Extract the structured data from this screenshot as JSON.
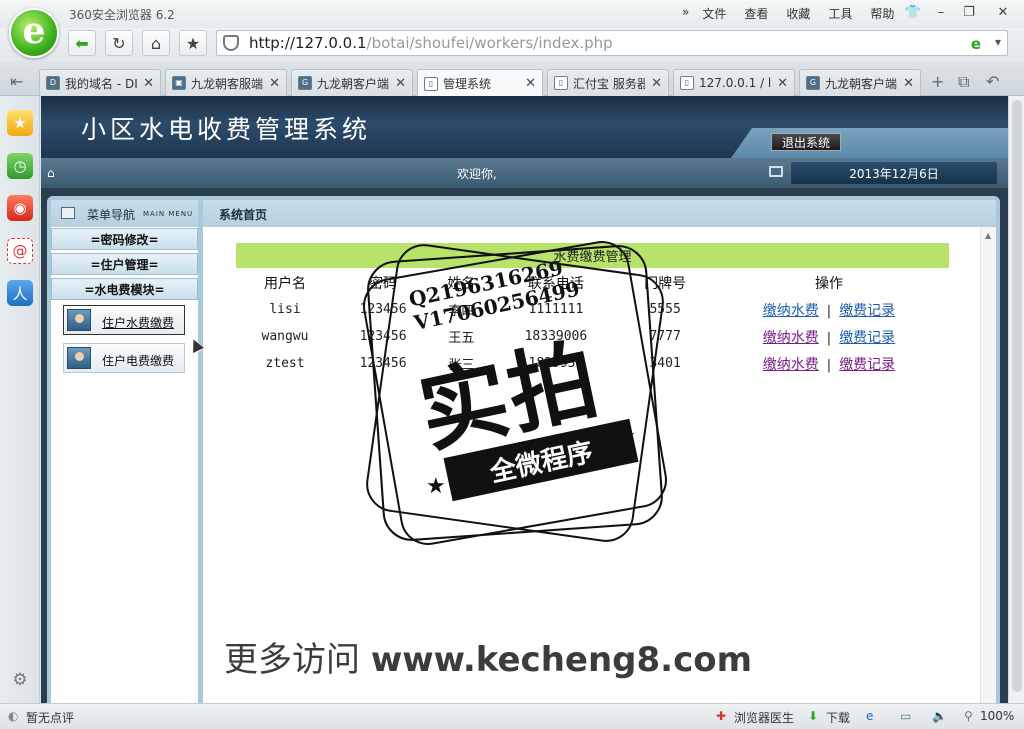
{
  "browser": {
    "app_title": "360安全浏览器 6.2",
    "menu": [
      "文件",
      "查看",
      "收藏",
      "工具",
      "帮助"
    ],
    "url_host": "http://127.0.0.1",
    "url_path": "/botai/shoufei/workers/index.php",
    "tabs": [
      {
        "label": "我的域名 - DI",
        "icon": "D"
      },
      {
        "label": "九龙朝客服端",
        "icon": "▣"
      },
      {
        "label": "九龙朝客户端",
        "icon": "G"
      },
      {
        "label": "管理系统",
        "icon": "▯"
      },
      {
        "label": "汇付宝 服务器",
        "icon": "▯"
      },
      {
        "label": "127.0.0.1 / lo",
        "icon": "▯"
      },
      {
        "label": "九龙朝客户端",
        "icon": "G"
      }
    ],
    "status_left": "暂无点评",
    "status_right": [
      "浏览器医生",
      "下载",
      "100%"
    ]
  },
  "site": {
    "title": "小区水电收费管理系统",
    "logout": "退出系统",
    "welcome": "欢迎你,",
    "date": "2013年12月6日"
  },
  "nav": {
    "title": "菜单导航",
    "subtitle": "MAIN MENU",
    "items": [
      "=密码修改=",
      "=住户管理=",
      "=水电费模块="
    ],
    "sub_items": [
      "住户水费缴费",
      "住户电费缴费"
    ]
  },
  "main": {
    "breadcrumb": "系统首页",
    "section_title": "水费缴费管理",
    "columns": [
      "用户名",
      "密码",
      "姓名",
      "联系电话",
      "门牌号",
      "操作"
    ],
    "rows": [
      {
        "username": "lisi",
        "password": "123456",
        "name": "李四",
        "phone": "1111111",
        "door": "5555",
        "pay": "缴纳水费",
        "history": "缴费记录"
      },
      {
        "username": "wangwu",
        "password": "123456",
        "name": "王五",
        "phone": "18339006",
        "door": "7777",
        "pay": "缴纳水费",
        "history": "缴费记录"
      },
      {
        "username": "ztest",
        "password": "123456",
        "name": "张三",
        "phone": "1829936",
        "door": "3401",
        "pay": "缴纳水费",
        "history": "缴费记录"
      }
    ]
  },
  "watermark": {
    "qq": "Q2196316269",
    "v": "V17060256499",
    "big": "实拍",
    "ribbon": "全微程序",
    "footer_prefix": "更多访问",
    "footer_url": "www.kecheng8.com"
  }
}
